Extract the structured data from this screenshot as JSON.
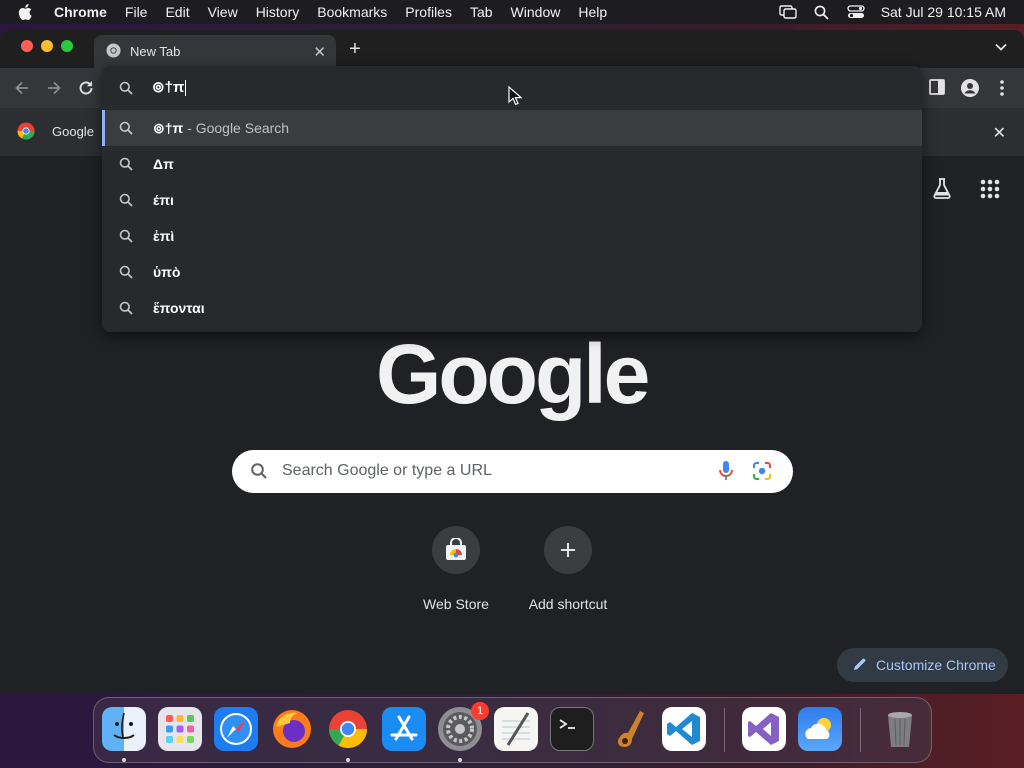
{
  "menubar": {
    "app_name": "Chrome",
    "items": [
      "File",
      "Edit",
      "View",
      "History",
      "Bookmarks",
      "Profiles",
      "Tab",
      "Window",
      "Help"
    ],
    "clock": "Sat Jul 29  10:15 AM"
  },
  "tab": {
    "title": "New Tab",
    "close_glyph": "✕"
  },
  "new_tab_glyph": "+",
  "bookmark_bar": {
    "label": "Google",
    "close_glyph": "✕"
  },
  "omnibox": {
    "input_value": "⊚†π",
    "suggestions": [
      {
        "text": "⊚†π",
        "suffix": " - Google Search",
        "selected": true
      },
      {
        "text": "Δπ",
        "suffix": "",
        "selected": false
      },
      {
        "text": "έπι",
        "suffix": "",
        "selected": false
      },
      {
        "text": "ἐπὶ",
        "suffix": "",
        "selected": false
      },
      {
        "text": "ὑπὸ",
        "suffix": "",
        "selected": false
      },
      {
        "text": "ἕπονται",
        "suffix": "",
        "selected": false
      }
    ]
  },
  "page": {
    "logo": "Google",
    "search_placeholder": "Search Google or type a URL",
    "shortcuts": [
      {
        "label": "Web Store"
      },
      {
        "label": "Add shortcut"
      }
    ],
    "customize_label": "Customize Chrome"
  },
  "dock": {
    "apps": [
      "finder-icon",
      "launchpad-icon",
      "safari-icon",
      "firefox-icon",
      "chrome-icon",
      "app-store-icon",
      "system-settings-icon",
      "textedit-icon",
      "terminal-icon",
      "garageband-icon",
      "vscode-icon",
      "visual-studio-icon",
      "weather-icon",
      "trash-icon"
    ],
    "settings_badge": "1"
  },
  "colors": {
    "accent": "#8ab4f8",
    "tab_bg": "#35363a",
    "page_bg": "#202124"
  }
}
